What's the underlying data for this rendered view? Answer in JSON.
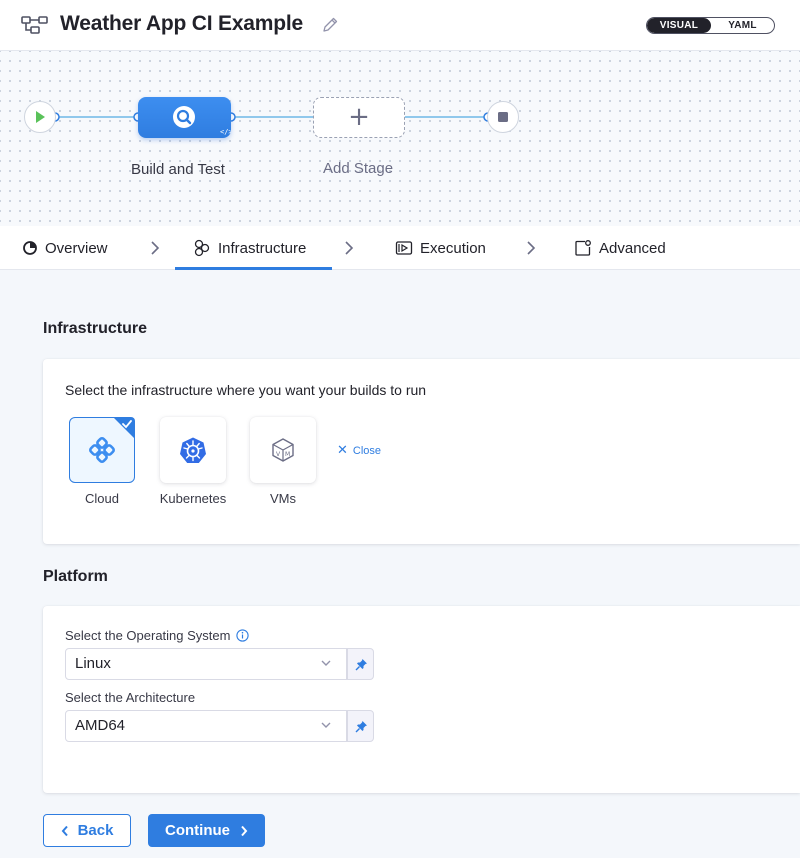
{
  "header": {
    "title": "Weather App CI Example",
    "view_toggle": {
      "visual": "VISUAL",
      "yaml": "YAML",
      "selected": "VISUAL"
    }
  },
  "pipeline": {
    "stages": [
      {
        "label": "Build and Test",
        "icon": "ci-search-icon"
      },
      {
        "label": "Add Stage",
        "icon": "plus-icon"
      }
    ]
  },
  "tabs": [
    {
      "label": "Overview",
      "icon": "overview-icon"
    },
    {
      "label": "Infrastructure",
      "icon": "infrastructure-icon",
      "active": true
    },
    {
      "label": "Execution",
      "icon": "execution-icon"
    },
    {
      "label": "Advanced",
      "icon": "advanced-icon"
    }
  ],
  "infrastructure": {
    "title": "Infrastructure",
    "description": "Select the infrastructure where you want your builds to run",
    "options": [
      {
        "label": "Cloud",
        "selected": true
      },
      {
        "label": "Kubernetes"
      },
      {
        "label": "VMs"
      }
    ],
    "close_label": "Close"
  },
  "platform": {
    "title": "Platform",
    "os_label": "Select the Operating System",
    "os_value": "Linux",
    "arch_label": "Select the Architecture",
    "arch_value": "AMD64"
  },
  "actions": {
    "back": "Back",
    "continue": "Continue"
  },
  "colors": {
    "accent": "#2f7de0",
    "selected_bg": "#eef7ff",
    "text": "#22222a"
  }
}
